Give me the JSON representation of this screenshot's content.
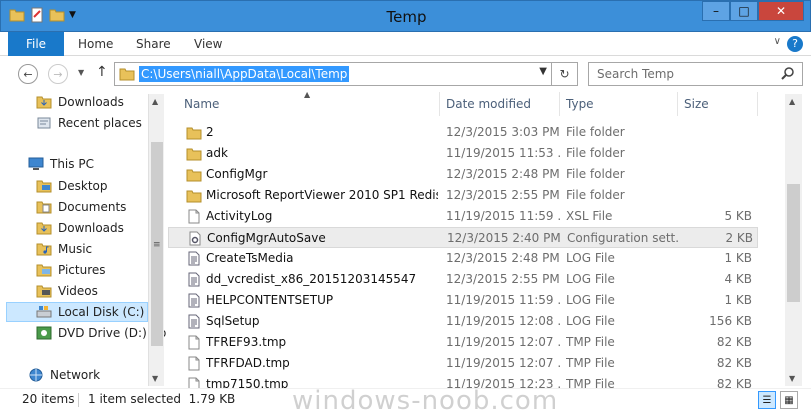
{
  "window": {
    "title": "Temp"
  },
  "ribbon": {
    "tabs": [
      "File",
      "Home",
      "Share",
      "View"
    ]
  },
  "address": {
    "path": "C:\\Users\\niall\\AppData\\Local\\Temp"
  },
  "search": {
    "placeholder": "Search Temp"
  },
  "nav": {
    "items": [
      {
        "label": "Downloads",
        "icon": "downloads-icon"
      },
      {
        "label": "Recent places",
        "icon": "recent-places-icon"
      },
      {
        "label": "This PC",
        "icon": "this-pc-icon"
      },
      {
        "label": "Desktop",
        "icon": "folder-icon"
      },
      {
        "label": "Documents",
        "icon": "folder-icon"
      },
      {
        "label": "Downloads",
        "icon": "downloads-icon"
      },
      {
        "label": "Music",
        "icon": "music-icon"
      },
      {
        "label": "Pictures",
        "icon": "pictures-icon"
      },
      {
        "label": "Videos",
        "icon": "videos-icon"
      },
      {
        "label": "Local Disk (C:)",
        "icon": "drive-icon"
      },
      {
        "label": "DVD Drive (D:) Co",
        "icon": "dvd-icon"
      },
      {
        "label": "Network",
        "icon": "network-icon"
      }
    ]
  },
  "columns": {
    "name": "Name",
    "date": "Date modified",
    "type": "Type",
    "size": "Size"
  },
  "files": [
    {
      "name": "2",
      "date": "12/3/2015 3:03 PM",
      "type": "File folder",
      "size": "",
      "icon": "folder"
    },
    {
      "name": "adk",
      "date": "11/19/2015 11:53 ...",
      "type": "File folder",
      "size": "",
      "icon": "folder"
    },
    {
      "name": "ConfigMgr",
      "date": "12/3/2015 2:48 PM",
      "type": "File folder",
      "size": "",
      "icon": "folder"
    },
    {
      "name": "Microsoft ReportViewer 2010 SP1 Redistri...",
      "date": "12/3/2015 2:55 PM",
      "type": "File folder",
      "size": "",
      "icon": "folder"
    },
    {
      "name": "ActivityLog",
      "date": "11/19/2015 11:59 ...",
      "type": "XSL File",
      "size": "5 KB",
      "icon": "doc"
    },
    {
      "name": "ConfigMgrAutoSave",
      "date": "12/3/2015 2:40 PM",
      "type": "Configuration sett...",
      "size": "2 KB",
      "icon": "config"
    },
    {
      "name": "CreateTsMedia",
      "date": "12/3/2015 2:48 PM",
      "type": "LOG File",
      "size": "1 KB",
      "icon": "log"
    },
    {
      "name": "dd_vcredist_x86_20151203145547",
      "date": "12/3/2015 2:55 PM",
      "type": "LOG File",
      "size": "4 KB",
      "icon": "log"
    },
    {
      "name": "HELPCONTENTSETUP",
      "date": "11/19/2015 11:59 ...",
      "type": "LOG File",
      "size": "1 KB",
      "icon": "log"
    },
    {
      "name": "SqlSetup",
      "date": "11/19/2015 12:08 ...",
      "type": "LOG File",
      "size": "156 KB",
      "icon": "log"
    },
    {
      "name": "TFREF93.tmp",
      "date": "11/19/2015 12:07 ...",
      "type": "TMP File",
      "size": "82 KB",
      "icon": "doc"
    },
    {
      "name": "TFRFDAD.tmp",
      "date": "11/19/2015 12:07 ...",
      "type": "TMP File",
      "size": "82 KB",
      "icon": "doc"
    },
    {
      "name": "tmp7150.tmp",
      "date": "11/19/2015 12:23 ...",
      "type": "TMP File",
      "size": "82 KB",
      "icon": "doc"
    }
  ],
  "status": {
    "count": "20 items",
    "selection": "1 item selected  1.79 KB"
  },
  "watermark": "windows-noob.com"
}
